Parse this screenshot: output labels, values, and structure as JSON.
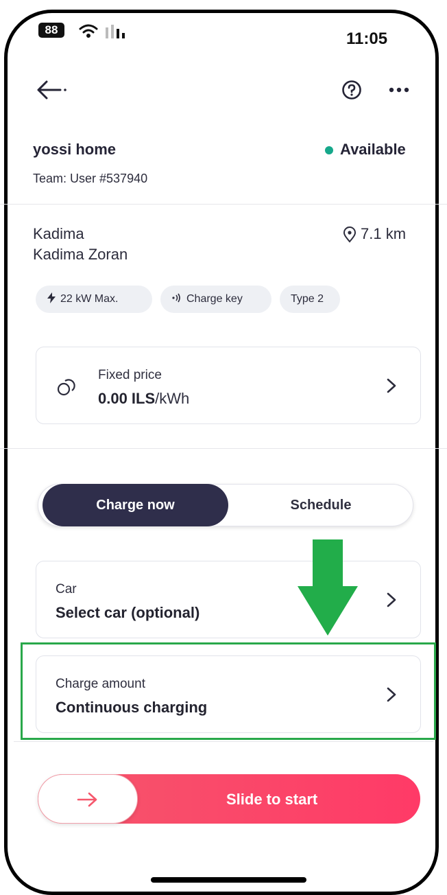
{
  "status_bar": {
    "battery": "88",
    "time": "11:05"
  },
  "header": {
    "back_icon": "arrow-left-icon",
    "help_icon": "question-circle-icon",
    "more_icon": "ellipsis-icon"
  },
  "station": {
    "name": "yossi home",
    "team": "Team: User #537940",
    "status": "Available",
    "status_color": "#16a88b",
    "city": "Kadima",
    "address": "Kadima Zoran",
    "distance": "7.1 km"
  },
  "chips": [
    {
      "label": "22 kW Max.",
      "icon": "bolt-icon"
    },
    {
      "label": "Charge key",
      "icon": "nfc-icon"
    },
    {
      "label": "Type 2",
      "icon": ""
    }
  ],
  "price": {
    "label": "Fixed price",
    "amount": "0.00 ILS",
    "unit": "/kWh"
  },
  "tabs": {
    "active": "Charge now",
    "inactive": "Schedule"
  },
  "car": {
    "label": "Car",
    "value": "Select car (optional)"
  },
  "charge_amount": {
    "label": "Charge amount",
    "value": "Continuous charging"
  },
  "slider": {
    "label": "Slide to start"
  },
  "colors": {
    "accent": "#2f2e4b",
    "slider": "#ff3a67",
    "annotation": "#29a84a"
  }
}
